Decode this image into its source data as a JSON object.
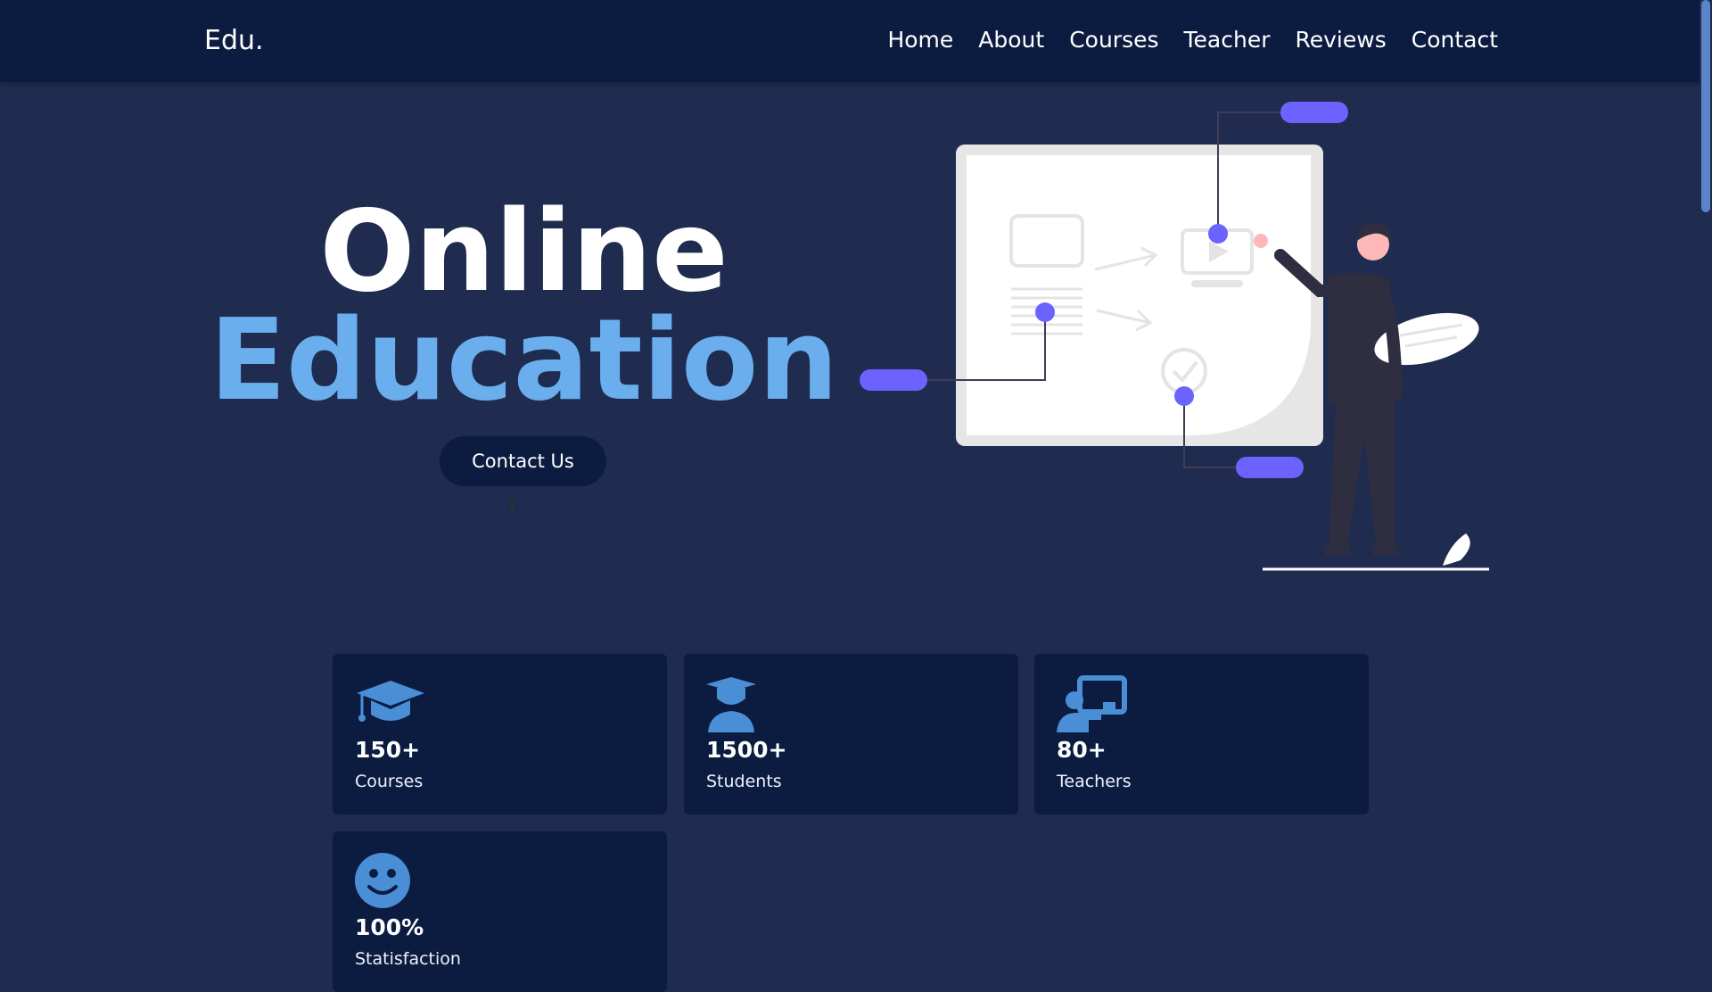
{
  "nav": {
    "logo": "Edu.",
    "links": [
      {
        "label": "Home"
      },
      {
        "label": "About"
      },
      {
        "label": "Courses"
      },
      {
        "label": "Teacher"
      },
      {
        "label": "Reviews"
      },
      {
        "label": "Contact"
      }
    ]
  },
  "hero": {
    "title_line1": "Online",
    "title_line2": "Education",
    "cta_label": "Contact Us"
  },
  "stats": [
    {
      "count": "150+",
      "label": "Courses",
      "icon": "graduation-cap-icon"
    },
    {
      "count": "1500+",
      "label": "Students",
      "icon": "student-icon"
    },
    {
      "count": "80+",
      "label": "Teachers",
      "icon": "teacher-board-icon"
    },
    {
      "count": "100%",
      "label": "Statisfaction",
      "icon": "smile-icon"
    }
  ],
  "colors": {
    "background": "#1f2b4f",
    "navbar": "#0c1c40",
    "accent": "#6aaeee",
    "icon": "#4a8ed6",
    "illustration_accent": "#6c63ff"
  }
}
